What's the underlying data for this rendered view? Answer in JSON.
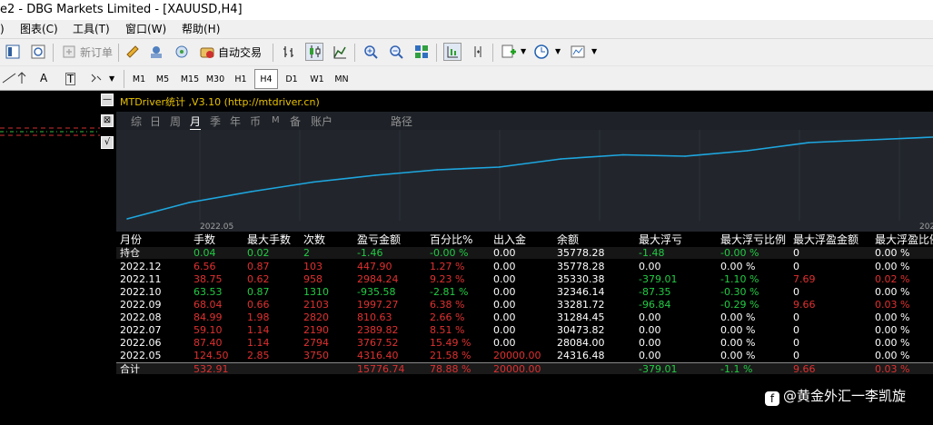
{
  "window": {
    "title": "e2 - DBG Markets Limited - [XAUUSD,H4]"
  },
  "menu": {
    "items": [
      ")",
      "图表(C)",
      "工具(T)",
      "窗口(W)",
      "帮助(H)"
    ]
  },
  "toolbar1": {
    "new_order": "新订单",
    "auto_trade": "自动交易"
  },
  "toolbar2": {
    "font_a": "A",
    "text_t": "T",
    "timeframes": [
      "M1",
      "M5",
      "M15",
      "M30",
      "H1",
      "H4",
      "D1",
      "W1",
      "MN"
    ],
    "active_timeframe": "H4"
  },
  "side_buttons": [
    "—",
    "⊠",
    "√"
  ],
  "panel": {
    "title": "MTDriver统计 ,V3.10 (http://mtdriver.cn)",
    "tabs": [
      "综",
      "日",
      "周",
      "月",
      "季",
      "年",
      "币",
      "M",
      "备",
      "账户",
      "路径"
    ],
    "active_tab": "月",
    "colors": {
      "line": "#1ea7e0",
      "profit": "#e03030",
      "loss": "#22cc44",
      "neutral": "#ffffff"
    }
  },
  "chart_data": {
    "type": "line",
    "x_tick_labels": [
      "2022.05",
      "202"
    ],
    "series": [
      {
        "values": [
          0,
          0.12,
          0.2,
          0.27,
          0.32,
          0.36,
          0.38,
          0.44,
          0.47,
          0.46,
          0.5,
          0.56,
          0.58,
          0.6
        ]
      }
    ],
    "grid": true
  },
  "table": {
    "headers": [
      "月份",
      "手数",
      "最大手数",
      "次数",
      "盈亏金额",
      "百分比%",
      "出入金",
      "余额",
      "最大浮亏",
      "最大浮亏比例",
      "最大浮盈金额",
      "最大浮盈比例"
    ],
    "holding": {
      "label": "持仓",
      "cells": [
        "0.04",
        "0.02",
        "2",
        "-1.46",
        "-0.00 %",
        "0.00",
        "35778.28",
        "-1.48",
        "-0.00 %",
        "0",
        "0.00 %"
      ],
      "colors": [
        "g",
        "g",
        "g",
        "g",
        "g",
        "w",
        "w",
        "g",
        "g",
        "w",
        "w"
      ]
    },
    "rows": [
      {
        "month": "2022.12",
        "cells": [
          "6.56",
          "0.87",
          "103",
          "447.90",
          "1.27 %",
          "0.00",
          "35778.28",
          "0.00",
          "0.00 %",
          "0",
          "0.00 %"
        ],
        "colors": [
          "r",
          "r",
          "r",
          "r",
          "r",
          "w",
          "w",
          "w",
          "w",
          "w",
          "w"
        ]
      },
      {
        "month": "2022.11",
        "cells": [
          "38.75",
          "0.62",
          "958",
          "2984.24",
          "9.23 %",
          "0.00",
          "35330.38",
          "-379.01",
          "-1.10 %",
          "7.69",
          "0.02 %"
        ],
        "colors": [
          "r",
          "r",
          "r",
          "r",
          "r",
          "w",
          "w",
          "g",
          "g",
          "r",
          "r"
        ]
      },
      {
        "month": "2022.10",
        "cells": [
          "63.53",
          "0.87",
          "1310",
          "-935.58",
          "-2.81 %",
          "0.00",
          "32346.14",
          "-87.35",
          "-0.30 %",
          "0",
          "0.00 %"
        ],
        "colors": [
          "g",
          "g",
          "g",
          "g",
          "g",
          "w",
          "w",
          "g",
          "g",
          "w",
          "w"
        ]
      },
      {
        "month": "2022.09",
        "cells": [
          "68.04",
          "0.66",
          "2103",
          "1997.27",
          "6.38 %",
          "0.00",
          "33281.72",
          "-96.84",
          "-0.29 %",
          "9.66",
          "0.03 %"
        ],
        "colors": [
          "r",
          "r",
          "r",
          "r",
          "r",
          "w",
          "w",
          "g",
          "g",
          "r",
          "r"
        ]
      },
      {
        "month": "2022.08",
        "cells": [
          "84.99",
          "1.98",
          "2820",
          "810.63",
          "2.66 %",
          "0.00",
          "31284.45",
          "0.00",
          "0.00 %",
          "0",
          "0.00 %"
        ],
        "colors": [
          "r",
          "r",
          "r",
          "r",
          "r",
          "w",
          "w",
          "w",
          "w",
          "w",
          "w"
        ]
      },
      {
        "month": "2022.07",
        "cells": [
          "59.10",
          "1.14",
          "2190",
          "2389.82",
          "8.51 %",
          "0.00",
          "30473.82",
          "0.00",
          "0.00 %",
          "0",
          "0.00 %"
        ],
        "colors": [
          "r",
          "r",
          "r",
          "r",
          "r",
          "w",
          "w",
          "w",
          "w",
          "w",
          "w"
        ]
      },
      {
        "month": "2022.06",
        "cells": [
          "87.40",
          "1.14",
          "2794",
          "3767.52",
          "15.49 %",
          "0.00",
          "28084.00",
          "0.00",
          "0.00 %",
          "0",
          "0.00 %"
        ],
        "colors": [
          "r",
          "r",
          "r",
          "r",
          "r",
          "w",
          "w",
          "w",
          "w",
          "w",
          "w"
        ]
      },
      {
        "month": "2022.05",
        "cells": [
          "124.50",
          "2.85",
          "3750",
          "4316.40",
          "21.58 %",
          "20000.00",
          "24316.48",
          "0.00",
          "0.00 %",
          "0",
          "0.00 %"
        ],
        "colors": [
          "r",
          "r",
          "r",
          "r",
          "r",
          "r",
          "w",
          "w",
          "w",
          "w",
          "w"
        ]
      }
    ],
    "total": {
      "label": "合计",
      "cells": [
        "532.91",
        "",
        "",
        "15776.74",
        "78.88 %",
        "20000.00",
        "",
        "-379.01",
        "-1.1 %",
        "9.66",
        "0.03 %"
      ],
      "colors": [
        "r",
        "w",
        "w",
        "r",
        "r",
        "r",
        "w",
        "g",
        "g",
        "r",
        "r"
      ]
    }
  },
  "watermark": {
    "text": "@黄金外汇一李凯旋"
  }
}
